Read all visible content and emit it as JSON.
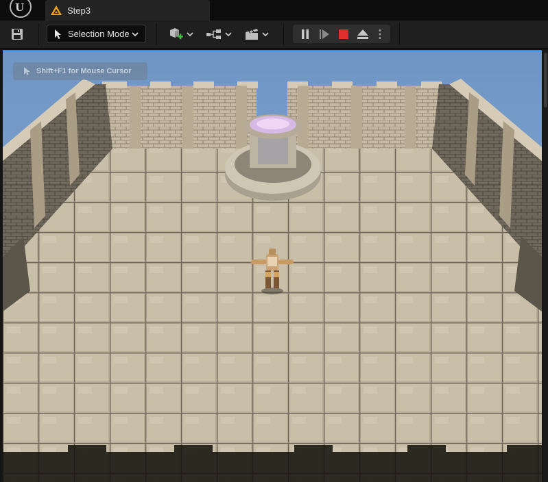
{
  "tabs": [
    {
      "label": "Step3",
      "icon": "unreal-map-icon",
      "active": true
    }
  ],
  "toolbar": {
    "save_icon": "save-icon",
    "mode_label": "Selection Mode",
    "mode_icon": "selection-cursor-icon",
    "quick_add_icon": "add-actor-icon",
    "blueprints_icon": "blueprint-icon",
    "cinematics_icon": "clapperboard-icon",
    "play_controls": [
      "pause-icon",
      "resume-icon",
      "stop-icon",
      "eject-icon",
      "more-options-icon"
    ]
  },
  "viewport": {
    "hint_text": "Shift+F1 for Mouse Cursor"
  },
  "colors": {
    "accent": "#2d8ff0",
    "stop": "#e0302c",
    "add_green": "#3fbf3f",
    "tab_icon_orange": "#f0a020"
  }
}
